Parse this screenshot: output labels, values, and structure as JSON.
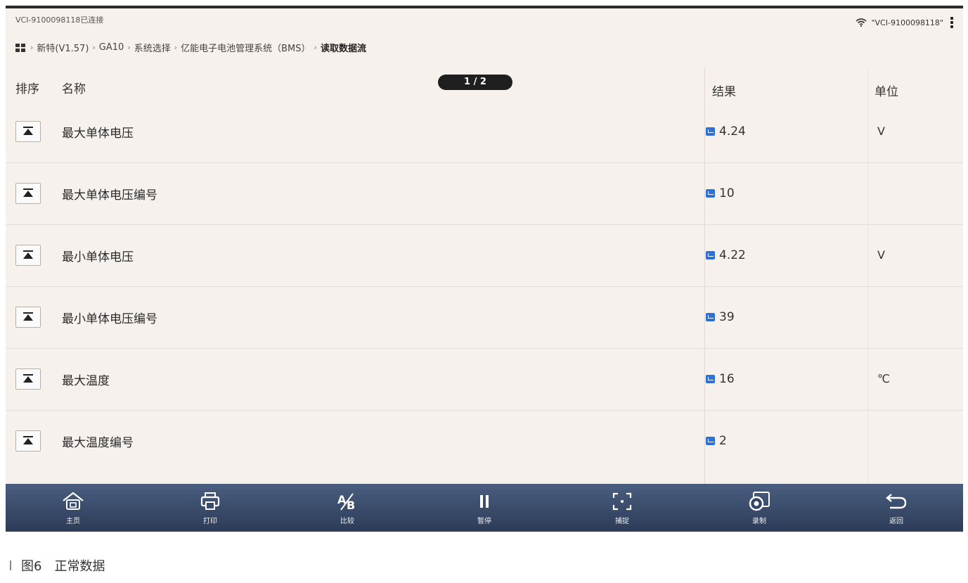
{
  "status": {
    "connection_text": "VCI-9100098118已连接",
    "vci_name": "\"VCI-9100098118\""
  },
  "breadcrumb": [
    "新特(V1.57)",
    "GA10",
    "系统选择",
    "亿能电子电池管理系统（BMS）",
    "读取数据流"
  ],
  "table": {
    "headers": {
      "sort": "排序",
      "name": "名称",
      "result": "结果",
      "unit": "单位"
    },
    "pager": "1 / 2",
    "rows": [
      {
        "name": "最大单体电压",
        "value": "4.24",
        "unit": "V"
      },
      {
        "name": "最大单体电压编号",
        "value": "10",
        "unit": ""
      },
      {
        "name": "最小单体电压",
        "value": "4.22",
        "unit": "V"
      },
      {
        "name": "最小单体电压编号",
        "value": "39",
        "unit": ""
      },
      {
        "name": "最大温度",
        "value": "16",
        "unit": "℃"
      },
      {
        "name": "最大温度编号",
        "value": "2",
        "unit": ""
      }
    ]
  },
  "toolbar": {
    "home": "主页",
    "print": "打印",
    "compare": "比较",
    "pause": "暂停",
    "capture": "捕捉",
    "record": "录制",
    "back": "返回"
  },
  "caption": "图6　正常数据",
  "colors": {
    "bar_top": "#4a5e7f",
    "bar_bottom": "#2c3b57",
    "accent": "#2f6fd6"
  }
}
